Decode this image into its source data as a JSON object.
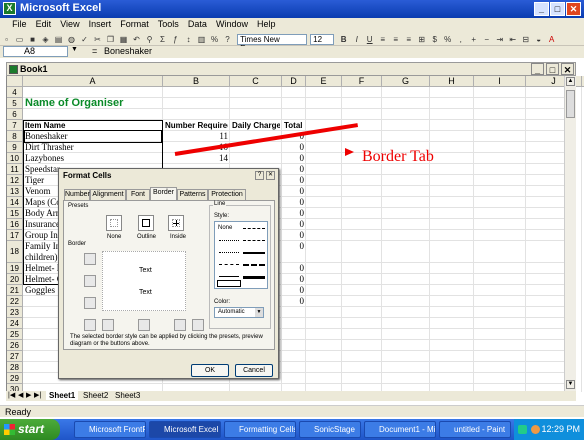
{
  "window": {
    "title": "Microsoft Excel"
  },
  "menu": [
    "File",
    "Edit",
    "View",
    "Insert",
    "Format",
    "Tools",
    "Data",
    "Window",
    "Help"
  ],
  "toolbar": {
    "font": "Times New Roman",
    "size": "12"
  },
  "formula_bar": {
    "cell": "A8",
    "fx": "=",
    "value": "Boneshaker"
  },
  "workbook": {
    "title": "Book1"
  },
  "columns": [
    "A",
    "B",
    "C",
    "D",
    "E",
    "F",
    "G",
    "H",
    "I",
    "J",
    "K"
  ],
  "rows": [
    {
      "n": "4",
      "a": "",
      "b": "",
      "c": "",
      "d": ""
    },
    {
      "n": "5",
      "a": "Name of Organiser",
      "b": "",
      "c": "",
      "d": ""
    },
    {
      "n": "6",
      "a": "",
      "b": "",
      "c": "",
      "d": ""
    },
    {
      "n": "7",
      "a": "Item Name",
      "b": "Number Required",
      "c": "Daily Charge",
      "d": "Total"
    },
    {
      "n": "8",
      "a": "Boneshaker",
      "b": "11",
      "c": "",
      "d": "0"
    },
    {
      "n": "9",
      "a": "Dirt Thrasher",
      "b": "10",
      "c": "",
      "d": "0"
    },
    {
      "n": "10",
      "a": "Lazybones",
      "b": "14",
      "c": "",
      "d": "0"
    },
    {
      "n": "11",
      "a": "Speedstar",
      "b": "",
      "c": "",
      "d": "0"
    },
    {
      "n": "12",
      "a": "Tiger",
      "b": "",
      "c": "",
      "d": "0"
    },
    {
      "n": "13",
      "a": "Venom",
      "b": "",
      "c": "",
      "d": "0"
    },
    {
      "n": "14",
      "a": "Maps (Co",
      "b": "",
      "c": "",
      "d": "0"
    },
    {
      "n": "15",
      "a": "Body Arm",
      "b": "",
      "c": "",
      "d": "0"
    },
    {
      "n": "16",
      "a": "Insurance",
      "b": "",
      "c": "",
      "d": "0"
    },
    {
      "n": "17",
      "a": "Group Ins",
      "b": "",
      "c": "",
      "d": "0"
    },
    {
      "n": "18",
      "a": "Family Ins",
      "a2": "children)",
      "b": "",
      "c": "",
      "d": "0"
    },
    {
      "n": "19",
      "a": "Helmet- E",
      "b": "",
      "c": "",
      "d": "0"
    },
    {
      "n": "20",
      "a": "Helmet- C",
      "b": "",
      "c": "",
      "d": "0"
    },
    {
      "n": "21",
      "a": "Goggles",
      "b": "",
      "c": "",
      "d": "0"
    },
    {
      "n": "22",
      "a": "",
      "b": "",
      "c": "",
      "d": "0"
    },
    {
      "n": "23",
      "a": "",
      "b": "",
      "c": "",
      "d": ""
    },
    {
      "n": "24",
      "a": "",
      "b": "",
      "c": "",
      "d": ""
    },
    {
      "n": "25",
      "a": "",
      "b": "",
      "c": "",
      "d": ""
    },
    {
      "n": "26",
      "a": "",
      "b": "",
      "c": "",
      "d": ""
    },
    {
      "n": "27",
      "a": "",
      "b": "",
      "c": "",
      "d": ""
    },
    {
      "n": "28",
      "a": "",
      "b": "",
      "c": "",
      "d": ""
    },
    {
      "n": "29",
      "a": "",
      "b": "",
      "c": "",
      "d": ""
    },
    {
      "n": "30",
      "a": "",
      "b": "",
      "c": "",
      "d": ""
    }
  ],
  "sheet_tabs": [
    "Sheet1",
    "Sheet2",
    "Sheet3"
  ],
  "status": "Ready",
  "dialog": {
    "title": "Format Cells",
    "tabs": [
      "Number",
      "Alignment",
      "Font",
      "Border",
      "Patterns",
      "Protection"
    ],
    "presets_label": "Presets",
    "presets": [
      "None",
      "Outline",
      "Inside"
    ],
    "border_label": "Border",
    "preview_text": "Text",
    "line_label": "Line",
    "style_label": "Style:",
    "style_none": "None",
    "color_label": "Color:",
    "color_value": "Automatic",
    "help": "The selected border style can be applied by clicking the presets, preview diagram or the buttons above.",
    "ok": "OK",
    "cancel": "Cancel"
  },
  "annotation": "Border Tab",
  "taskbar": {
    "start": "start",
    "tasks": [
      "Microsoft FrontP...",
      "Microsoft Excel",
      "Formatting Cells ...",
      "SonicStage",
      "Document1 - Mic...",
      "untitled - Paint"
    ],
    "clock": "12:29 PM"
  },
  "colors": {
    "title_blue": "#0a3cb0",
    "heading_green": "#0a8a28",
    "annotation_red": "#e00000"
  }
}
